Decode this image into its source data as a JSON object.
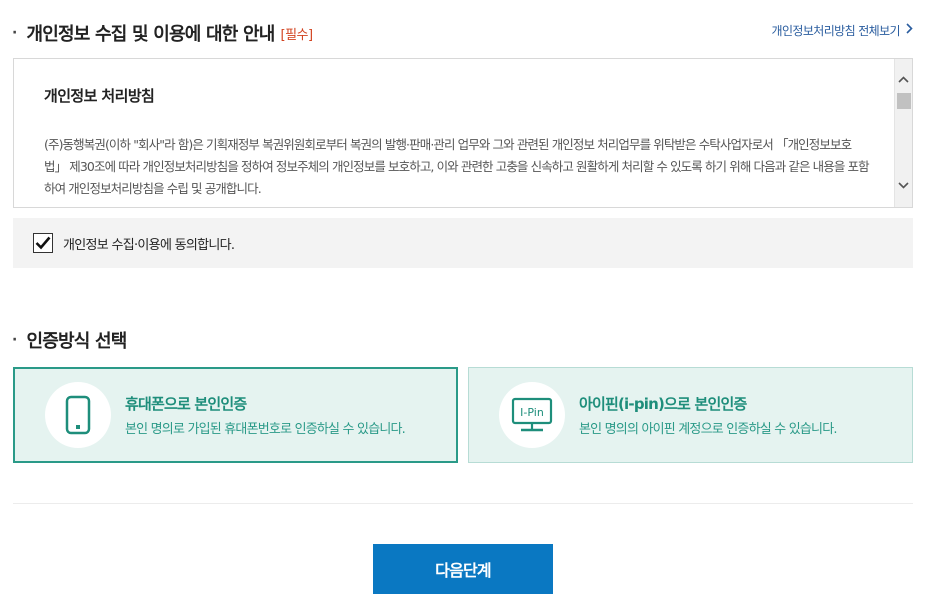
{
  "privacy": {
    "section_title": "개인정보 수집 및 이용에 대한 안내",
    "required_tag": "[필수]",
    "full_policy_link": "개인정보처리방침 전체보기",
    "policy_heading": "개인정보 처리방침",
    "policy_text": "(주)동행복권(이하 \"회사\"라 함)은 기획재정부 복권위원회로부터 복권의 발행·판매·관리 업무와 그와 관련된 개인정보 처리업무를 위탁받은 수탁사업자로서 「개인정보보호법」 제30조에 따라 개인정보처리방침을 정하여 정보주체의 개인정보를 보호하고, 이와 관련한 고충을 신속하고 원활하게 처리할 수 있도록 하기 위해 다음과 같은 내용을 포함하여 개인정보처리방침을 수립 및 공개합니다.",
    "agree_label": "개인정보 수집·이용에 동의합니다.",
    "agree_checked": true
  },
  "auth": {
    "section_title": "인증방식 선택",
    "options": [
      {
        "title": "휴대폰으로 본인인증",
        "description": "본인 명의로 가입된 휴대폰번호로 인증하실 수 있습니다.",
        "icon": "mobile-phone-icon",
        "selected": true
      },
      {
        "title": "아이핀(i-pin)으로 본인인증",
        "description": "본인 명의의 아이핀 계정으로 인증하실 수 있습니다.",
        "icon": "ipin-monitor-icon",
        "icon_label": "I-Pin",
        "selected": false
      }
    ]
  },
  "actions": {
    "next_label": "다음단계"
  },
  "colors": {
    "accent_teal": "#2a9a88",
    "card_bg": "#e5f3f0",
    "button_blue": "#0a78c2",
    "required_red": "#d2421f",
    "link_blue": "#2a5d9f"
  }
}
